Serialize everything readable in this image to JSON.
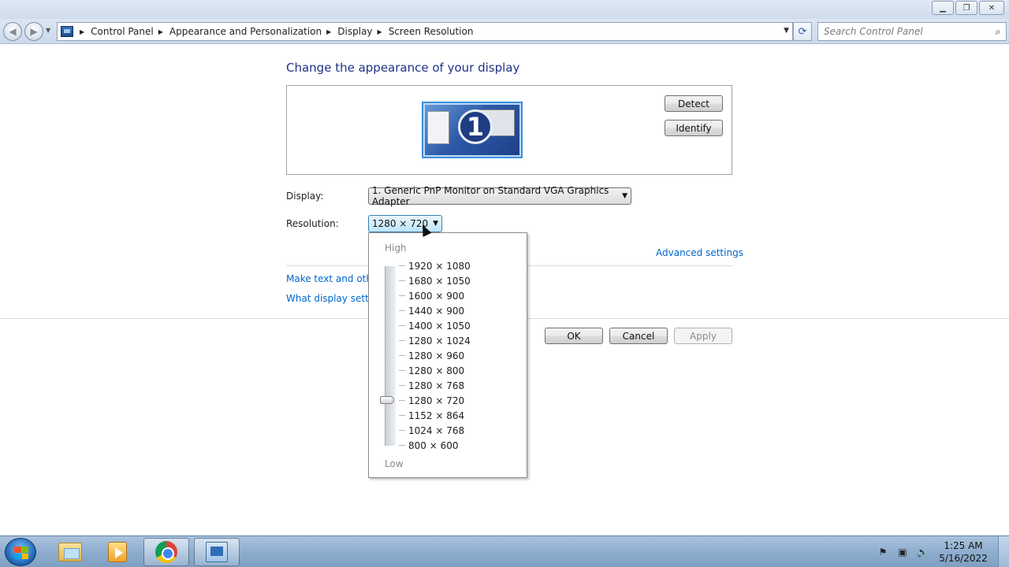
{
  "window": {
    "minimize_icon": "minimize-icon",
    "maximize_icon": "restore-icon",
    "close_icon": "close-icon"
  },
  "address": {
    "breadcrumbs": [
      "Control Panel",
      "Appearance and Personalization",
      "Display",
      "Screen Resolution"
    ],
    "search_placeholder": "Search Control Panel"
  },
  "main": {
    "heading": "Change the appearance of your display",
    "monitor_number": "1",
    "detect_label": "Detect",
    "identify_label": "Identify",
    "display_label": "Display:",
    "display_value": "1. Generic PnP Monitor on Standard VGA Graphics Adapter",
    "resolution_label": "Resolution:",
    "resolution_value": "1280 × 720",
    "advanced_link": "Advanced settings",
    "make_text_link": "Make text and other",
    "what_display_link": "What display setting",
    "ok_label": "OK",
    "cancel_label": "Cancel",
    "apply_label": "Apply"
  },
  "resolution_dropdown": {
    "high_label": "High",
    "low_label": "Low",
    "selected": "1280 × 720",
    "options": [
      "1920 × 1080",
      "1680 × 1050",
      "1600 × 900",
      "1440 × 900",
      "1400 × 1050",
      "1280 × 1024",
      "1280 × 960",
      "1280 × 800",
      "1280 × 768",
      "1280 × 720",
      "1152 × 864",
      "1024 × 768",
      "800 × 600"
    ]
  },
  "taskbar": {
    "items": [
      "start-button",
      "windows-explorer",
      "media-player",
      "google-chrome",
      "control-panel"
    ],
    "clock_time": "1:25 AM",
    "clock_date": "5/16/2022"
  }
}
